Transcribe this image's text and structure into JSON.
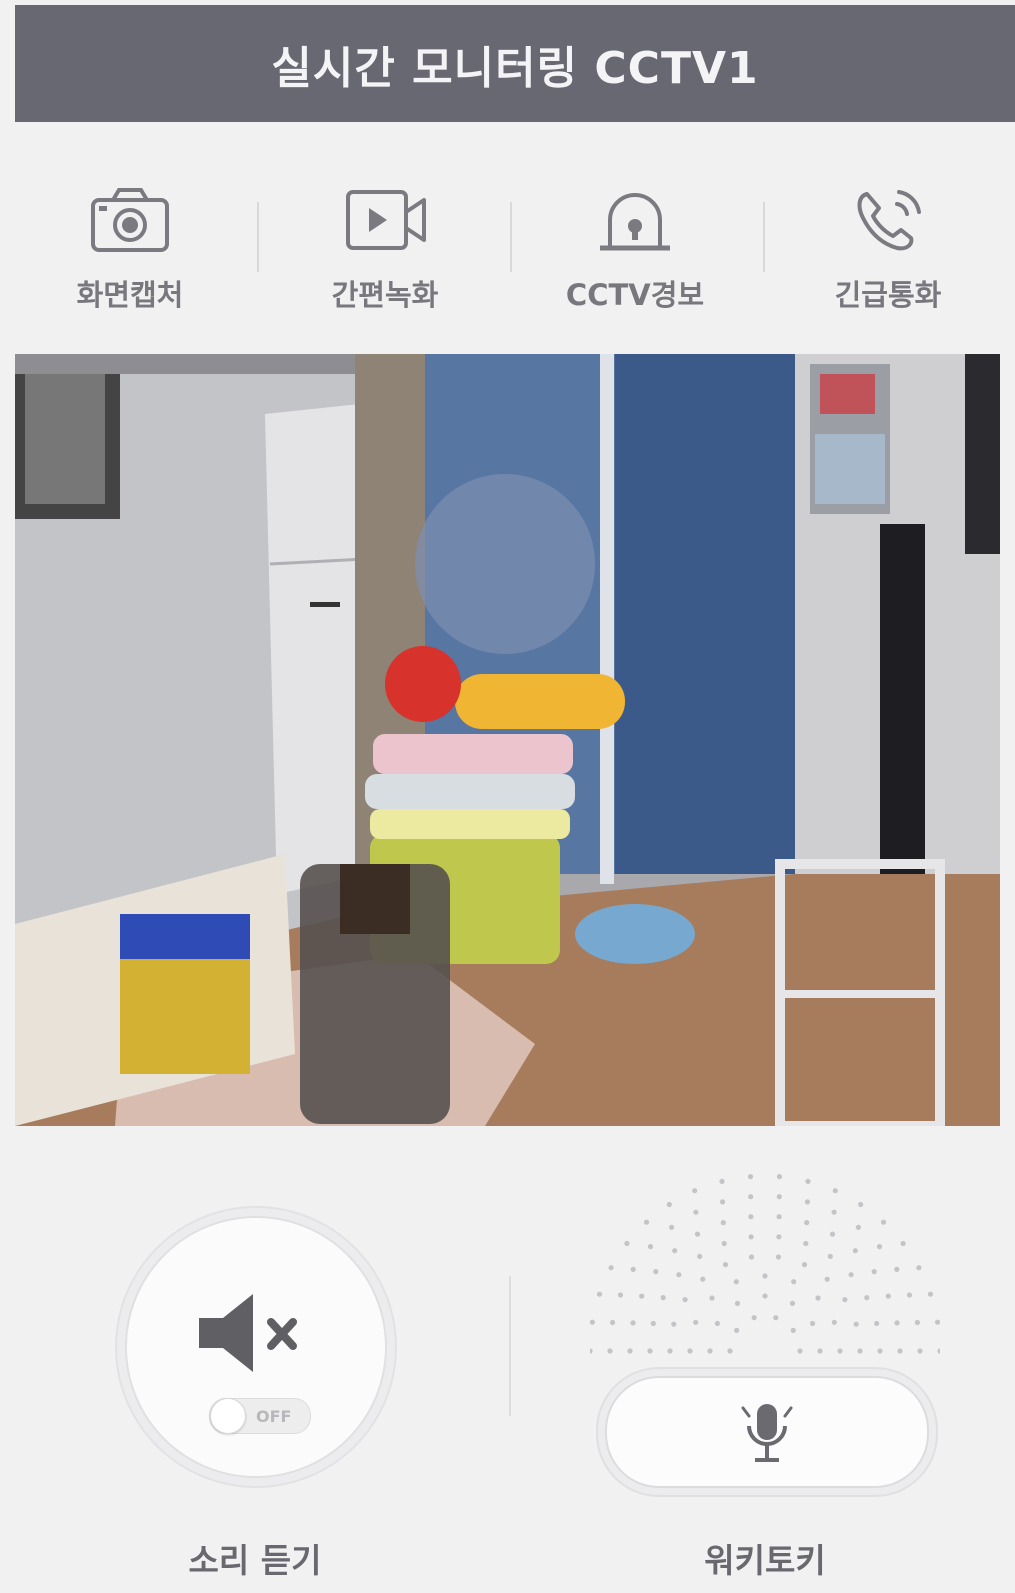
{
  "header": {
    "title": "실시간 모니터링 CCTV1"
  },
  "toolbar": {
    "items": [
      {
        "label": "화면캡처",
        "icon": "camera-icon"
      },
      {
        "label": "간편녹화",
        "icon": "video-record-icon"
      },
      {
        "label": "CCTV경보",
        "icon": "alarm-siren-icon"
      },
      {
        "label": "긴급통화",
        "icon": "emergency-call-icon"
      }
    ]
  },
  "video": {
    "description_icon": "live-video-feed"
  },
  "controls": {
    "sound": {
      "label": "소리 듣기",
      "toggle_state": "OFF",
      "icon": "speaker-muted-icon"
    },
    "talk": {
      "label": "워키토키",
      "icon": "microphone-icon"
    }
  },
  "colors": {
    "header_bg": "#686873",
    "page_bg": "#f1f1f2",
    "label_text": "#77777d"
  }
}
